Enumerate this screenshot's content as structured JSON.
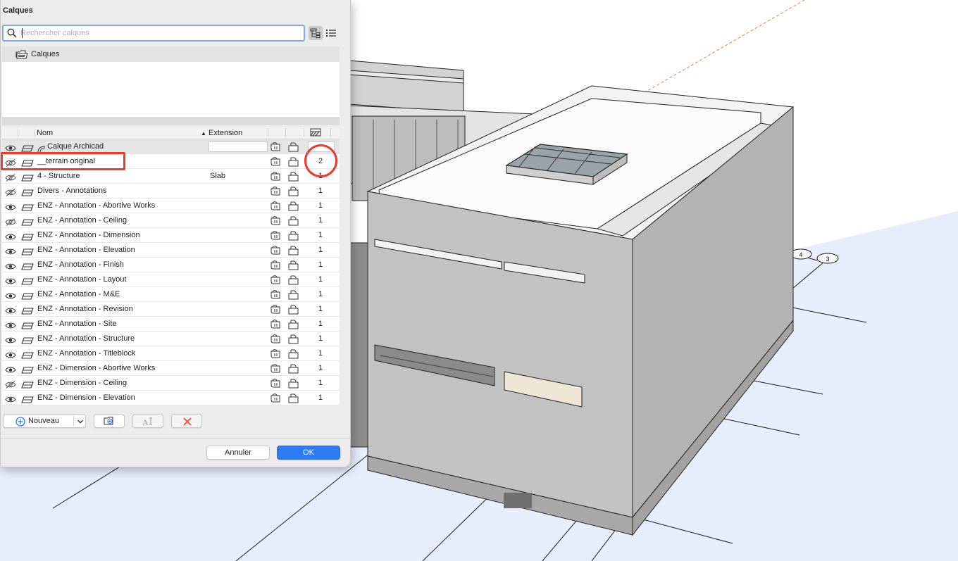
{
  "dialog": {
    "title": "Calques",
    "search": {
      "placeholder": "Rechercher calques",
      "value": ""
    },
    "tree": {
      "root_label": "Calques"
    },
    "columns": {
      "name": "Nom",
      "extension": "Extension"
    },
    "layers": [
      {
        "visible": true,
        "name": "Calque Archicad",
        "extension": "",
        "intersection": "",
        "special": true
      },
      {
        "visible": false,
        "name": "__terrain original",
        "extension": "",
        "intersection": "2"
      },
      {
        "visible": false,
        "name": "4 - Structure",
        "extension": "Slab",
        "intersection": "1"
      },
      {
        "visible": false,
        "name": "Divers - Annotations",
        "extension": "",
        "intersection": "1"
      },
      {
        "visible": true,
        "name": "ENZ - Annotation - Abortive Works",
        "extension": "",
        "intersection": "1"
      },
      {
        "visible": false,
        "name": "ENZ - Annotation - Ceiling",
        "extension": "",
        "intersection": "1"
      },
      {
        "visible": true,
        "name": "ENZ - Annotation - Dimension",
        "extension": "",
        "intersection": "1"
      },
      {
        "visible": true,
        "name": "ENZ - Annotation - Elevation",
        "extension": "",
        "intersection": "1"
      },
      {
        "visible": true,
        "name": "ENZ - Annotation - Finish",
        "extension": "",
        "intersection": "1"
      },
      {
        "visible": true,
        "name": "ENZ - Annotation - Layout",
        "extension": "",
        "intersection": "1"
      },
      {
        "visible": true,
        "name": "ENZ - Annotation - M&E",
        "extension": "",
        "intersection": "1"
      },
      {
        "visible": true,
        "name": "ENZ - Annotation - Revision",
        "extension": "",
        "intersection": "1"
      },
      {
        "visible": true,
        "name": "ENZ - Annotation - Site",
        "extension": "",
        "intersection": "1"
      },
      {
        "visible": true,
        "name": "ENZ - Annotation - Structure",
        "extension": "",
        "intersection": "1"
      },
      {
        "visible": true,
        "name": "ENZ - Annotation - Titleblock",
        "extension": "",
        "intersection": "1"
      },
      {
        "visible": true,
        "name": "ENZ - Dimension - Abortive Works",
        "extension": "",
        "intersection": "1"
      },
      {
        "visible": false,
        "name": "ENZ - Dimension - Ceiling",
        "extension": "",
        "intersection": "1"
      },
      {
        "visible": true,
        "name": "ENZ - Dimension - Elevation",
        "extension": "",
        "intersection": "1"
      }
    ],
    "buttons": {
      "new": "Nouveau",
      "cancel": "Annuler",
      "ok": "OK"
    },
    "highlight_color": "#ee3a2c",
    "accent_color": "#2f7bf5"
  },
  "viewport": {
    "grid_markers": [
      "4",
      "3"
    ],
    "ground_color": "#e9ecfb",
    "wall_color": "#c2c2c2"
  }
}
